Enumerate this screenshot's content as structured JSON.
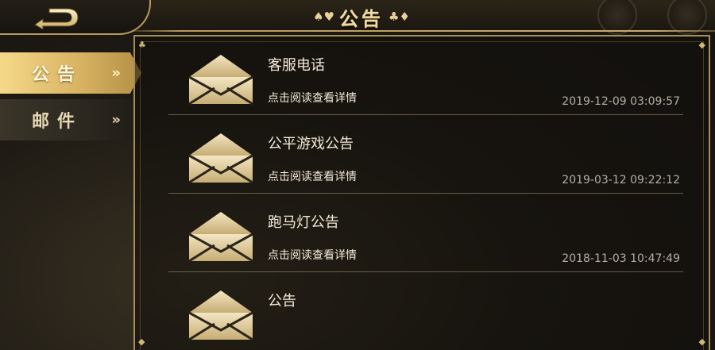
{
  "header": {
    "title": "公告",
    "suits_left": "♠♥",
    "suits_right": "♣♦"
  },
  "sidebar": {
    "items": [
      {
        "label": "公告",
        "active": true,
        "arrow": "»"
      },
      {
        "label": "邮件",
        "active": false,
        "arrow": "»"
      }
    ]
  },
  "icons": {
    "back": "back-arrow-icon",
    "envelope": "envelope-icon",
    "corner": "corner-ornament-icon"
  },
  "colors": {
    "accent_gold": "#d8b463",
    "border_gold": "#a88d57",
    "text_light": "#f2ead8",
    "timestamp": "#b3aea3"
  },
  "notices": [
    {
      "title": "客服电话",
      "subtitle": "点击阅读查看详情",
      "time": "2019-12-09 03:09:57"
    },
    {
      "title": "公平游戏公告",
      "subtitle": "点击阅读查看详情",
      "time": "2019-03-12 09:22:12"
    },
    {
      "title": "跑马灯公告",
      "subtitle": "点击阅读查看详情",
      "time": "2018-11-03 10:47:49"
    },
    {
      "title": "公告",
      "subtitle": "",
      "time": ""
    }
  ]
}
